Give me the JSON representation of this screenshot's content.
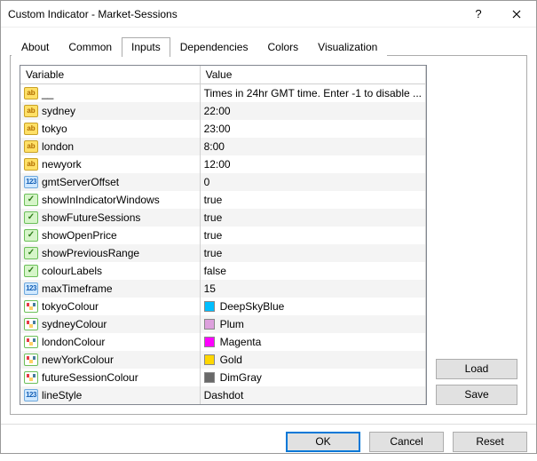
{
  "window": {
    "title": "Custom Indicator - Market-Sessions"
  },
  "tabs": {
    "about": "About",
    "common": "Common",
    "inputs": "Inputs",
    "dependencies": "Dependencies",
    "colors": "Colors",
    "visualization": "Visualization"
  },
  "headers": {
    "variable": "Variable",
    "value": "Value"
  },
  "rows": [
    {
      "type": "ab",
      "name": "__",
      "value": "Times in 24hr GMT time. Enter -1 to disable ...",
      "color": null
    },
    {
      "type": "ab",
      "name": "sydney",
      "value": "22:00",
      "color": null
    },
    {
      "type": "ab",
      "name": "tokyo",
      "value": "23:00",
      "color": null
    },
    {
      "type": "ab",
      "name": "london",
      "value": "8:00",
      "color": null
    },
    {
      "type": "ab",
      "name": "newyork",
      "value": "12:00",
      "color": null
    },
    {
      "type": "123",
      "name": "gmtServerOffset",
      "value": "0",
      "color": null
    },
    {
      "type": "bool",
      "name": "showInIndicatorWindows",
      "value": "true",
      "color": null
    },
    {
      "type": "bool",
      "name": "showFutureSessions",
      "value": "true",
      "color": null
    },
    {
      "type": "bool",
      "name": "showOpenPrice",
      "value": "true",
      "color": null
    },
    {
      "type": "bool",
      "name": "showPreviousRange",
      "value": "true",
      "color": null
    },
    {
      "type": "bool",
      "name": "colourLabels",
      "value": "false",
      "color": null
    },
    {
      "type": "123",
      "name": "maxTimeframe",
      "value": "15",
      "color": null
    },
    {
      "type": "color",
      "name": "tokyoColour",
      "value": "DeepSkyBlue",
      "color": "#00BFFF"
    },
    {
      "type": "color",
      "name": "sydneyColour",
      "value": "Plum",
      "color": "#DDA0DD"
    },
    {
      "type": "color",
      "name": "londonColour",
      "value": "Magenta",
      "color": "#FF00FF"
    },
    {
      "type": "color",
      "name": "newYorkColour",
      "value": "Gold",
      "color": "#FFD700"
    },
    {
      "type": "color",
      "name": "futureSessionColour",
      "value": "DimGray",
      "color": "#696969"
    },
    {
      "type": "123",
      "name": "lineStyle",
      "value": "Dashdot",
      "color": null
    }
  ],
  "side": {
    "load": "Load",
    "save": "Save"
  },
  "bottom": {
    "ok": "OK",
    "cancel": "Cancel",
    "reset": "Reset"
  }
}
